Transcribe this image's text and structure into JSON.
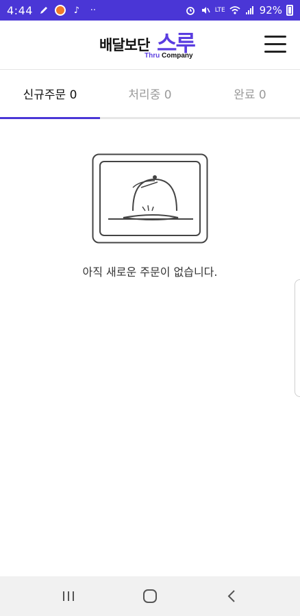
{
  "status_bar": {
    "time": "4:44",
    "icons_left": [
      "edit-icon",
      "orange-app-icon",
      "music-note-icon",
      "more-icon"
    ],
    "icons_right": [
      "alarm-icon",
      "mute-icon",
      "volte-icon",
      "wifi-icon",
      "signal-icon"
    ],
    "volte": "LTE",
    "battery": "92%"
  },
  "header": {
    "logo_main": "배달보단",
    "logo_accent": "스루",
    "logo_sub_thru": "Thru",
    "logo_sub_company": "Company",
    "accent_color": "#5a3de0"
  },
  "tabs": [
    {
      "label": "신규주문 0",
      "active": true
    },
    {
      "label": "처리중 0",
      "active": false
    },
    {
      "label": "완료 0",
      "active": false
    }
  ],
  "empty_state": {
    "icon": "food-cloche-icon",
    "message": "아직 새로운 주문이 없습니다."
  },
  "nav_bar": {
    "buttons": [
      "recents-icon",
      "home-icon",
      "back-icon"
    ]
  }
}
